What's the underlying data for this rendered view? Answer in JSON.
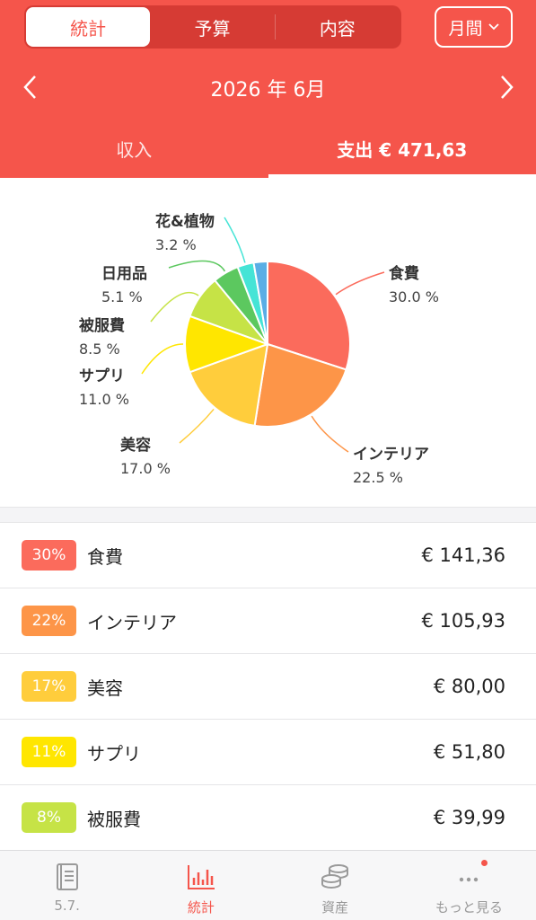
{
  "header": {
    "segments": [
      "統計",
      "予算",
      "内容"
    ],
    "active_segment": 0,
    "period_label": "月間",
    "month": "2026 年 6月",
    "tabs": [
      "収入",
      "支出 € 471,63"
    ],
    "active_tab": 1
  },
  "colors": {
    "primary": "#f5554b",
    "cat": [
      "#fb6b5c",
      "#fd9548",
      "#ffcd3c",
      "#ffe600",
      "#c6e346",
      "#5cc85f",
      "#45e4d6",
      "#5aaee5"
    ]
  },
  "chart_data": {
    "type": "pie",
    "slices": [
      {
        "label": "食費",
        "percent_label": "30.0 %",
        "value": 30.0
      },
      {
        "label": "インテリア",
        "percent_label": "22.5 %",
        "value": 22.5
      },
      {
        "label": "美容",
        "percent_label": "17.0 %",
        "value": 17.0
      },
      {
        "label": "サプリ",
        "percent_label": "11.0 %",
        "value": 11.0
      },
      {
        "label": "被服費",
        "percent_label": "8.5 %",
        "value": 8.5
      },
      {
        "label": "日用品",
        "percent_label": "5.1 %",
        "value": 5.1
      },
      {
        "label": "花&植物",
        "percent_label": "3.2 %",
        "value": 3.2
      },
      {
        "label": "",
        "percent_label": "",
        "value": 2.7
      }
    ]
  },
  "list": [
    {
      "badge": "30%",
      "name": "食費",
      "amount": "€ 141,36"
    },
    {
      "badge": "22%",
      "name": "インテリア",
      "amount": "€ 105,93"
    },
    {
      "badge": "17%",
      "name": "美容",
      "amount": "€ 80,00"
    },
    {
      "badge": "11%",
      "name": "サプリ",
      "amount": "€ 51,80"
    },
    {
      "badge": "8%",
      "name": "被服費",
      "amount": "€ 39,99"
    }
  ],
  "bottom_nav": [
    {
      "label": "5.7.",
      "icon": "book-icon"
    },
    {
      "label": "統計",
      "icon": "bar-chart-icon"
    },
    {
      "label": "資産",
      "icon": "coins-icon"
    },
    {
      "label": "もっと見る",
      "icon": "more-dots-icon"
    }
  ]
}
